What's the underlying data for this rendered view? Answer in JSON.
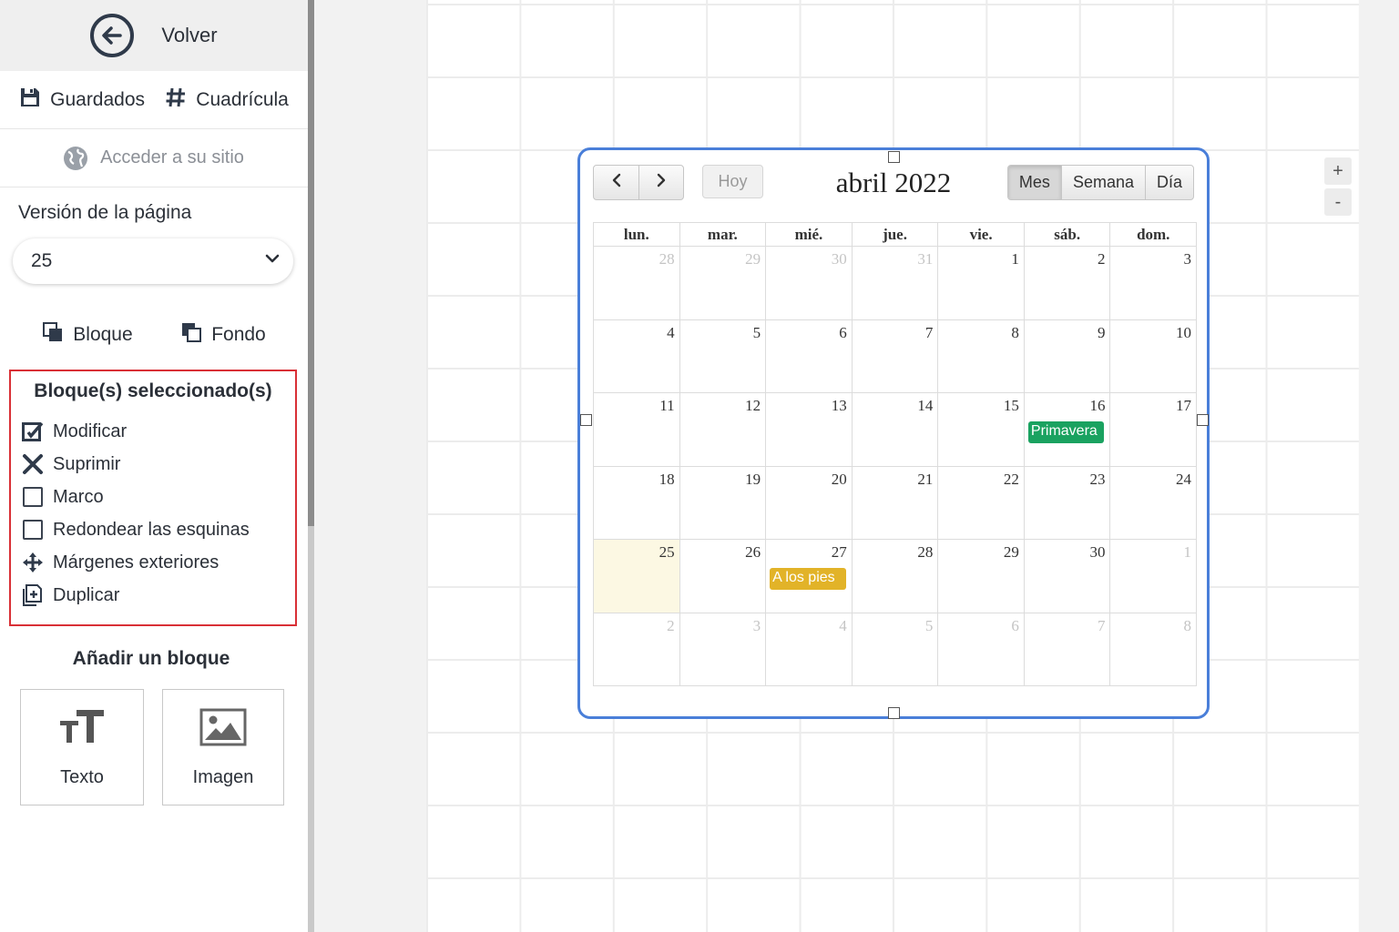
{
  "sidebar": {
    "back_label": "Volver",
    "saved_label": "Guardados",
    "grid_label": "Cuadrícula",
    "site_label": "Acceder a su sitio",
    "version_title": "Versión de la página",
    "version_value": "25",
    "block_label": "Bloque",
    "background_label": "Fondo",
    "selected_title": "Bloque(s) seleccionado(s)",
    "selected_actions": {
      "modify": "Modificar",
      "delete": "Suprimir",
      "frame": "Marco",
      "round_corners": "Redondear las esquinas",
      "outer_margins": "Márgenes exteriores",
      "duplicate": "Duplicar"
    },
    "add_title": "Añadir un bloque",
    "add_text_label": "Texto",
    "add_image_label": "Imagen"
  },
  "canvas": {
    "zoom_in": "+",
    "zoom_out": "-"
  },
  "calendar": {
    "title": "abril 2022",
    "today_label": "Hoy",
    "views": [
      "Mes",
      "Semana",
      "Día"
    ],
    "active_view": "Mes",
    "weekdays": [
      "lun.",
      "mar.",
      "mié.",
      "jue.",
      "vie.",
      "sáb.",
      "dom."
    ],
    "weeks": [
      [
        {
          "d": "28",
          "o": true
        },
        {
          "d": "29",
          "o": true
        },
        {
          "d": "30",
          "o": true
        },
        {
          "d": "31",
          "o": true
        },
        {
          "d": "1"
        },
        {
          "d": "2"
        },
        {
          "d": "3"
        }
      ],
      [
        {
          "d": "4"
        },
        {
          "d": "5"
        },
        {
          "d": "6"
        },
        {
          "d": "7"
        },
        {
          "d": "8"
        },
        {
          "d": "9"
        },
        {
          "d": "10"
        }
      ],
      [
        {
          "d": "11"
        },
        {
          "d": "12"
        },
        {
          "d": "13"
        },
        {
          "d": "14"
        },
        {
          "d": "15"
        },
        {
          "d": "16",
          "event": {
            "title": "Primavera",
            "color": "#1aa260"
          }
        },
        {
          "d": "17"
        }
      ],
      [
        {
          "d": "18"
        },
        {
          "d": "19"
        },
        {
          "d": "20"
        },
        {
          "d": "21"
        },
        {
          "d": "22"
        },
        {
          "d": "23"
        },
        {
          "d": "24"
        }
      ],
      [
        {
          "d": "25",
          "today": true
        },
        {
          "d": "26"
        },
        {
          "d": "27",
          "event": {
            "title": "A los pies",
            "color": "#e2b328"
          }
        },
        {
          "d": "28"
        },
        {
          "d": "29"
        },
        {
          "d": "30"
        },
        {
          "d": "1",
          "o": true
        }
      ],
      [
        {
          "d": "2",
          "o": true
        },
        {
          "d": "3",
          "o": true
        },
        {
          "d": "4",
          "o": true
        },
        {
          "d": "5",
          "o": true
        },
        {
          "d": "6",
          "o": true
        },
        {
          "d": "7",
          "o": true
        },
        {
          "d": "8",
          "o": true
        }
      ]
    ]
  },
  "colors": {
    "selection_border": "#4a7fd9",
    "selected_box_border": "#d93036",
    "today_bg": "#fcf8e3"
  }
}
